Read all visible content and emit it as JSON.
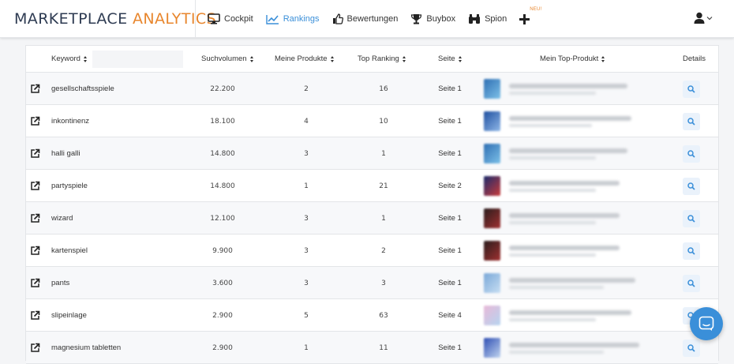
{
  "brand": {
    "part1": "MARKETPLACE",
    "part2": "ANALYTICS"
  },
  "nav": [
    {
      "label": "Cockpit",
      "icon": "monitor-icon",
      "active": false
    },
    {
      "label": "Rankings",
      "icon": "chart-line-icon",
      "active": true
    },
    {
      "label": "Bewertungen",
      "icon": "thumbs-up-icon",
      "active": false
    },
    {
      "label": "Buybox",
      "icon": "trophy-icon",
      "active": false
    },
    {
      "label": "Spion",
      "icon": "binoculars-icon",
      "active": false
    },
    {
      "label": "",
      "icon": "plus-icon",
      "badge": "NEU!",
      "active": false
    }
  ],
  "colors": {
    "accent": "#3a8fd9",
    "brand_orange": "#e8862d",
    "brand_dark": "#2e3b52"
  },
  "table": {
    "headers": {
      "keyword": "Keyword",
      "volume": "Suchvolumen",
      "my_products": "Meine Produkte",
      "top_ranking": "Top Ranking",
      "page": "Seite",
      "top_product": "Mein Top-Produkt",
      "details": "Details"
    },
    "keyword_filter_placeholder": "",
    "rows": [
      {
        "keyword": "gesellschaftsspiele",
        "volume": "22.200",
        "my_products": "2",
        "top_ranking": "16",
        "page": "Seite 1"
      },
      {
        "keyword": "inkontinenz",
        "volume": "18.100",
        "my_products": "4",
        "top_ranking": "10",
        "page": "Seite 1"
      },
      {
        "keyword": "halli galli",
        "volume": "14.800",
        "my_products": "3",
        "top_ranking": "1",
        "page": "Seite 1"
      },
      {
        "keyword": "partyspiele",
        "volume": "14.800",
        "my_products": "1",
        "top_ranking": "21",
        "page": "Seite 2"
      },
      {
        "keyword": "wizard",
        "volume": "12.100",
        "my_products": "3",
        "top_ranking": "1",
        "page": "Seite 1"
      },
      {
        "keyword": "kartenspiel",
        "volume": "9.900",
        "my_products": "3",
        "top_ranking": "2",
        "page": "Seite 1"
      },
      {
        "keyword": "pants",
        "volume": "3.600",
        "my_products": "3",
        "top_ranking": "3",
        "page": "Seite 1"
      },
      {
        "keyword": "slipeinlage",
        "volume": "2.900",
        "my_products": "5",
        "top_ranking": "63",
        "page": "Seite 4"
      },
      {
        "keyword": "magnesium tabletten",
        "volume": "2.900",
        "my_products": "1",
        "top_ranking": "11",
        "page": "Seite 1"
      }
    ]
  }
}
